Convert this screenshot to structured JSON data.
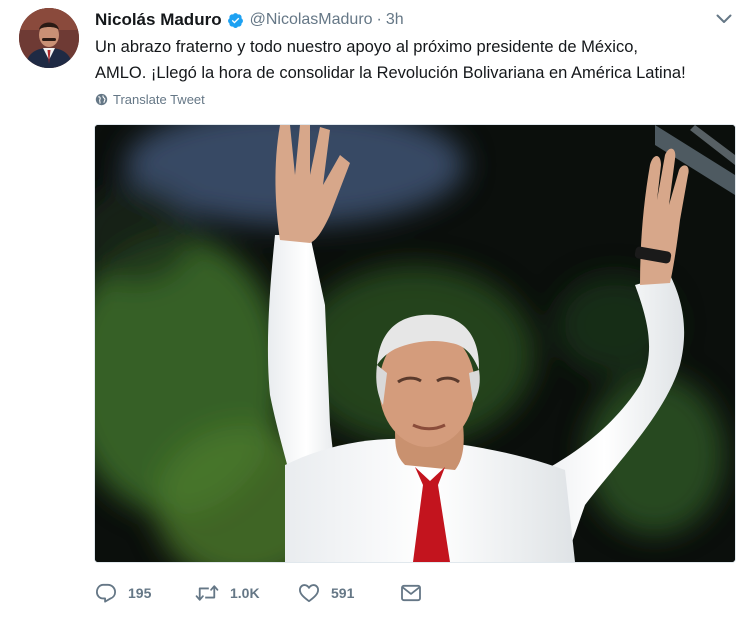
{
  "tweet": {
    "author": {
      "name": "Nicolás Maduro",
      "handle": "@NicolasMaduro",
      "verified": true
    },
    "separator": "·",
    "time": "3h",
    "text_lines": [
      "Un abrazo fraterno y todo nuestro apoyo al próximo presidente de México,",
      "AMLO. ¡Llegó la hora de consolidar la Revolución Bolivariana en América Latina!"
    ],
    "translate_label": "Translate Tweet",
    "actions": {
      "replies": "195",
      "retweets": "1.0K",
      "likes": "591"
    }
  },
  "icons": {
    "avatar": "profile-photo",
    "verified": "verified-badge-icon",
    "caret": "chevron-down-icon",
    "translate": "globe-icon",
    "reply": "reply-icon",
    "retweet": "retweet-icon",
    "like": "heart-icon",
    "dm": "envelope-icon"
  },
  "colors": {
    "name_text": "#14171a",
    "secondary_text": "#657786",
    "verified_blue": "#1da1f2"
  }
}
